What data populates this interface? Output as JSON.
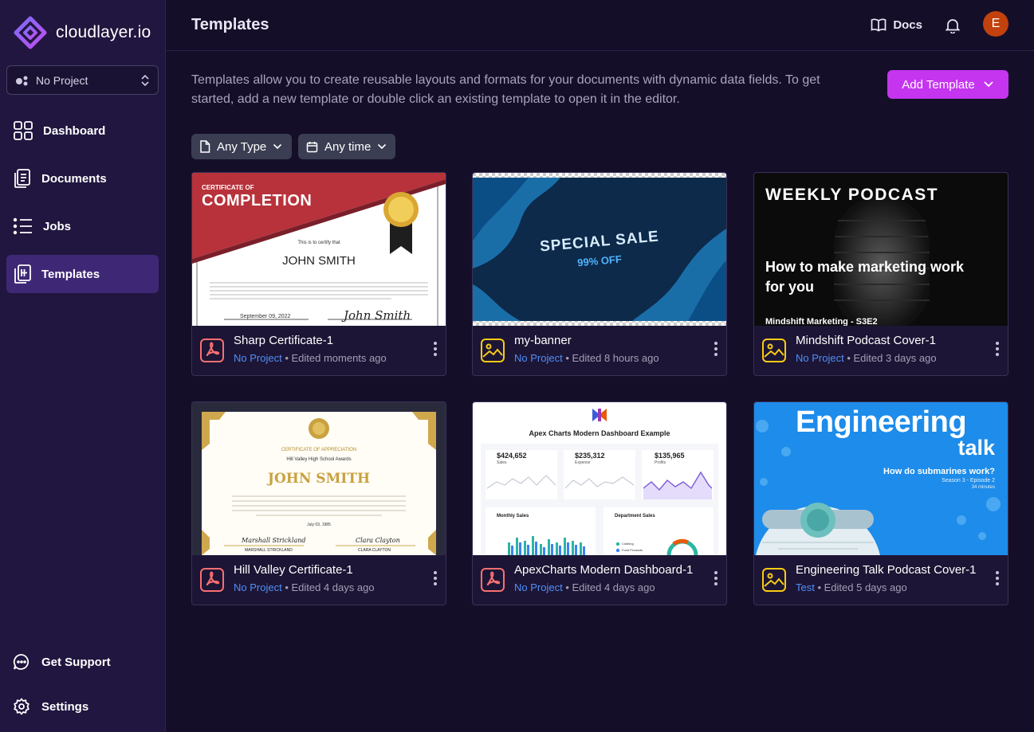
{
  "app": {
    "name": "cloudlayer.io"
  },
  "project_select": {
    "value": "No Project"
  },
  "sidebar": {
    "items": [
      {
        "label": "Dashboard",
        "icon": "grid-icon"
      },
      {
        "label": "Documents",
        "icon": "documents-icon"
      },
      {
        "label": "Jobs",
        "icon": "list-icon"
      },
      {
        "label": "Templates",
        "icon": "templates-icon",
        "active": true
      }
    ],
    "footer": [
      {
        "label": "Get Support",
        "icon": "chat-icon"
      },
      {
        "label": "Settings",
        "icon": "gear-icon"
      }
    ]
  },
  "header": {
    "title": "Templates",
    "docs_label": "Docs",
    "avatar_initial": "E"
  },
  "intro": "Templates allow you to create reusable layouts and formats for your documents with dynamic data fields. To get started, add a new template or double click an existing template to open it in the editor.",
  "add_button": {
    "label": "Add Template"
  },
  "filters": [
    {
      "label": "Any Type"
    },
    {
      "label": "Any time"
    }
  ],
  "colors": {
    "accent": "#c535f0",
    "active_nav": "#3e2876",
    "pdf": "#f87171",
    "image": "#facc15",
    "project_link": "#4f8ff7"
  },
  "cards": [
    {
      "title": "Sharp Certificate-1",
      "project": "No Project",
      "edited": "Edited moments ago",
      "type": "pdf",
      "preview": {
        "header_small": "CERTIFICATE OF",
        "header_big": "COMPLETION",
        "certify": "This is to certify that",
        "name": "JOHN SMITH",
        "date": "September 09, 2022",
        "signature": "John Smith"
      }
    },
    {
      "title": "my-banner",
      "project": "No Project",
      "edited": "Edited 8 hours ago",
      "type": "image",
      "preview": {
        "headline": "SPECIAL SALE",
        "offer": "99% OFF"
      }
    },
    {
      "title": "Mindshift Podcast Cover-1",
      "project": "No Project",
      "edited": "Edited 3 days ago",
      "type": "image",
      "preview": {
        "label": "WEEKLY PODCAST",
        "headline_1": "How to make marketing work",
        "headline_2": "for you",
        "footer": "Mindshift Marketing - S3E2"
      }
    },
    {
      "title": "Hill Valley Certificate-1",
      "project": "No Project",
      "edited": "Edited 4 days ago",
      "type": "pdf",
      "preview": {
        "header": "CERTIFICATE OF APPRECIATION",
        "sub": "Hill Valley High School Awards",
        "name": "JOHN SMITH",
        "date": "July 03, 1985",
        "sig1": "Marshall Strickland",
        "sig1_name": "MARSHALL STRICKLAND",
        "sig2": "Clara Clayton",
        "sig2_name": "CLARA CLAYTON"
      }
    },
    {
      "title": "ApexCharts Modern Dashboard-1",
      "project": "No Project",
      "edited": "Edited 4 days ago",
      "type": "pdf",
      "preview": {
        "heading": "Apex Charts Modern Dashboard Example",
        "stats": [
          {
            "value": "$424,652",
            "label": "Sales"
          },
          {
            "value": "$235,312",
            "label": "Expense"
          },
          {
            "value": "$135,965",
            "label": "Profits"
          }
        ],
        "panel_1": "Monthly Sales",
        "panel_2": "Department Sales",
        "legend_1": "Clothing",
        "legend_2": "Food Products"
      }
    },
    {
      "title": "Engineering Talk Podcast Cover-1",
      "project": "Test",
      "edited": "Edited 5 days ago",
      "type": "image",
      "preview": {
        "headline_1": "Engineering",
        "headline_2": "talk",
        "question": "How do submarines work?",
        "episode": "Season 3 - Episode 2",
        "duration": "34 minutes"
      }
    }
  ]
}
